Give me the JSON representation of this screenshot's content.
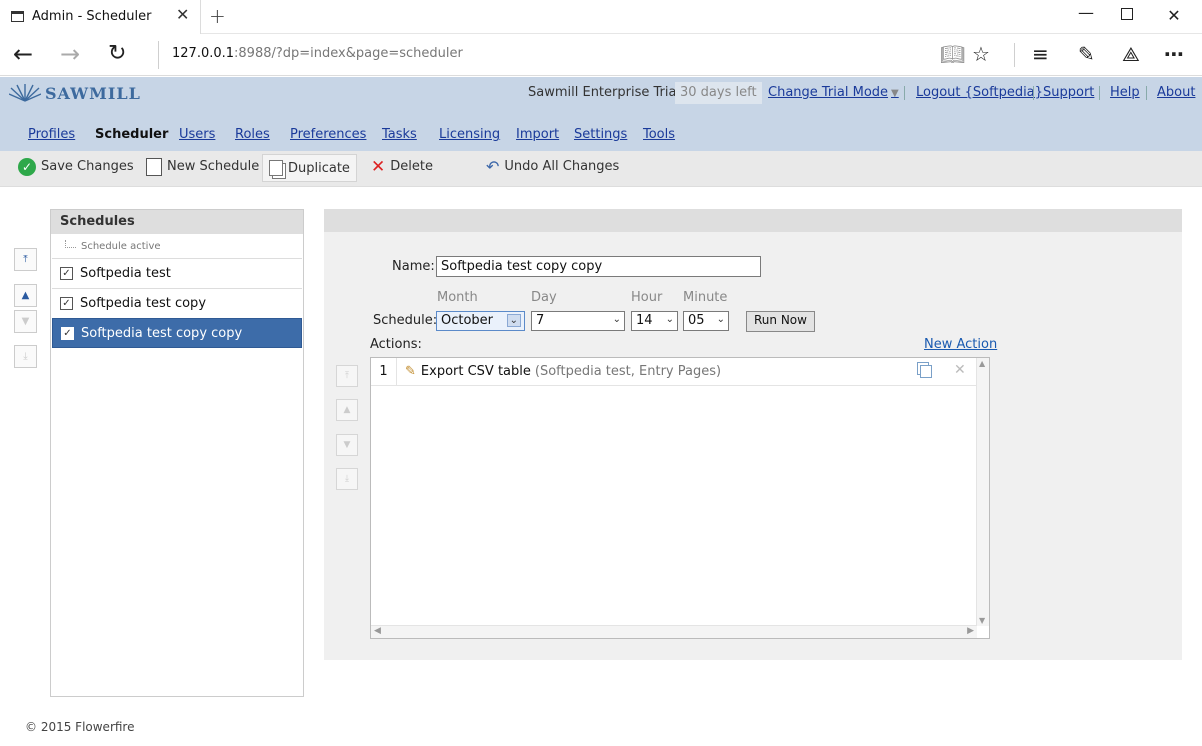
{
  "browser": {
    "tab_title": "Admin - Scheduler",
    "url_host": "127.0.0.1",
    "url_rest": ":8988/?dp=index&page=scheduler"
  },
  "header": {
    "logo_text": "SAWMILL",
    "trial_label": "Sawmill Enterprise Trial",
    "trial_badge": "30 days left",
    "links": {
      "change_trial_mode": "Change Trial Mode",
      "logout": "Logout {Softpedia}",
      "support": "Support",
      "help": "Help",
      "about": "About"
    },
    "nav": [
      "Profiles",
      "Scheduler",
      "Users",
      "Roles",
      "Preferences",
      "Tasks",
      "Licensing",
      "Import",
      "Settings",
      "Tools"
    ],
    "active_nav": "Scheduler"
  },
  "toolbar": {
    "save": "Save Changes",
    "new_schedule": "New Schedule",
    "duplicate": "Duplicate",
    "delete": "Delete",
    "undo_all": "Undo All Changes"
  },
  "schedules": {
    "title": "Schedules",
    "hint": "Schedule active",
    "items": [
      {
        "label": "Softpedia test",
        "active": true,
        "selected": false
      },
      {
        "label": "Softpedia test copy",
        "active": true,
        "selected": false
      },
      {
        "label": "Softpedia test copy copy",
        "active": true,
        "selected": true
      }
    ]
  },
  "form": {
    "name_label": "Name:",
    "name_value": "Softpedia test copy copy",
    "schedule_label": "Schedule:",
    "month_label": "Month",
    "day_label": "Day",
    "hour_label": "Hour",
    "minute_label": "Minute",
    "month_value": "October",
    "day_value": "7",
    "hour_value": "14",
    "minute_value": "05",
    "run_now": "Run Now",
    "actions_label": "Actions:",
    "new_action": "New Action"
  },
  "actions": [
    {
      "num": "1",
      "name": "Export CSV table",
      "detail": "(Softpedia test, Entry Pages)"
    }
  ],
  "footer": "© 2015 Flowerfire",
  "colors": {
    "header_bg": "#c7d5e6",
    "link": "#1a3a9a",
    "selected_row": "#3d6ca9",
    "save_green": "#2ea84a",
    "delete_red": "#dd2222"
  }
}
